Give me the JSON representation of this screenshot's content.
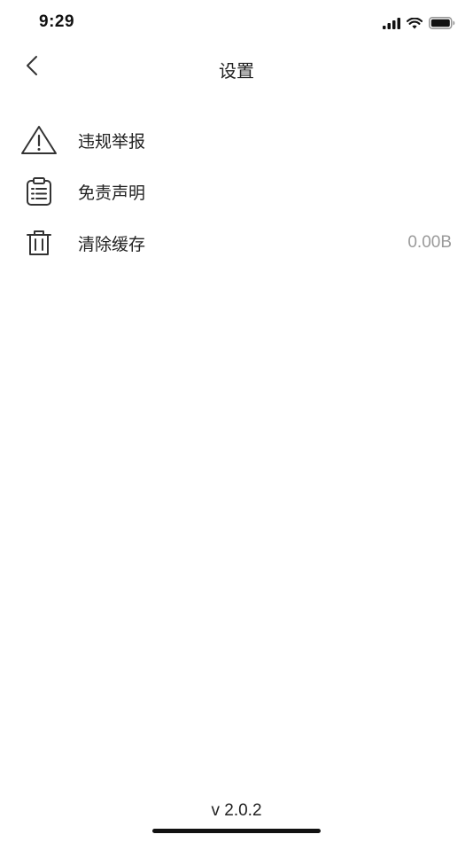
{
  "status_bar": {
    "time": "9:29",
    "icons": [
      "cellular-signal-icon",
      "wifi-icon",
      "battery-icon"
    ]
  },
  "nav": {
    "title": "设置",
    "back_icon": "chevron-left-icon"
  },
  "menu": [
    {
      "icon": "warning-triangle-icon",
      "label": "违规举报",
      "value": ""
    },
    {
      "icon": "clipboard-list-icon",
      "label": "免责声明",
      "value": ""
    },
    {
      "icon": "trash-icon",
      "label": "清除缓存",
      "value": "0.00B"
    }
  ],
  "footer": {
    "version": "v 2.0.2"
  },
  "colors": {
    "background": "#ffffff",
    "text": "#222222",
    "secondary_text": "#9a9a9a"
  }
}
